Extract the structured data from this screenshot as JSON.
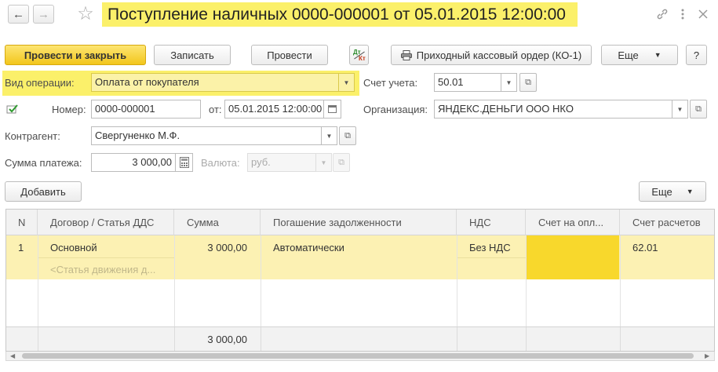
{
  "window": {
    "title": "Поступление наличных 0000-000001 от 05.01.2015 12:00:00",
    "back_icon": "←",
    "forward_icon": "→",
    "star_icon": "☆"
  },
  "toolbar": {
    "post_close": "Провести и закрыть",
    "save": "Записать",
    "post": "Провести",
    "dk_top": "Дт",
    "dk_bottom": "Кт",
    "print": "Приходный кассовый ордер (КО-1)",
    "more": "Еще",
    "help": "?"
  },
  "form": {
    "operation_label": "Вид операции:",
    "operation_value": "Оплата от покупателя",
    "account_label": "Счет учета:",
    "account_value": "50.01",
    "number_label": "Номер:",
    "number_value": "0000-000001",
    "date_label": "от:",
    "date_value": "05.01.2015 12:00:00",
    "org_label": "Организация:",
    "org_value": "ЯНДЕКС.ДЕНЬГИ ООО НКО",
    "contractor_label": "Контрагент:",
    "contractor_value": "Свергуненко М.Ф.",
    "amount_label": "Сумма платежа:",
    "amount_value": "3 000,00",
    "currency_label": "Валюта:",
    "currency_value": "руб."
  },
  "table_toolbar": {
    "add": "Добавить",
    "more": "Еще"
  },
  "table": {
    "columns": [
      "N",
      "Договор / Статья ДДС",
      "Сумма",
      "Погашение задолженности",
      "НДС",
      "Счет на опл...",
      "Счет расчетов"
    ],
    "rows": [
      {
        "n": "1",
        "contract": "Основной",
        "contract_sub": "<Статья движения д...",
        "sum": "3 000,00",
        "repayment": "Автоматически",
        "vat": "Без НДС",
        "invoice": "",
        "account": "62.01"
      }
    ],
    "footer_sum": "3 000,00"
  },
  "colors": {
    "highlight": "#fbf06a",
    "row_selected": "#fcf1b3",
    "cell_focused": "#f8d82c",
    "primary_button": "#f2c61c"
  }
}
